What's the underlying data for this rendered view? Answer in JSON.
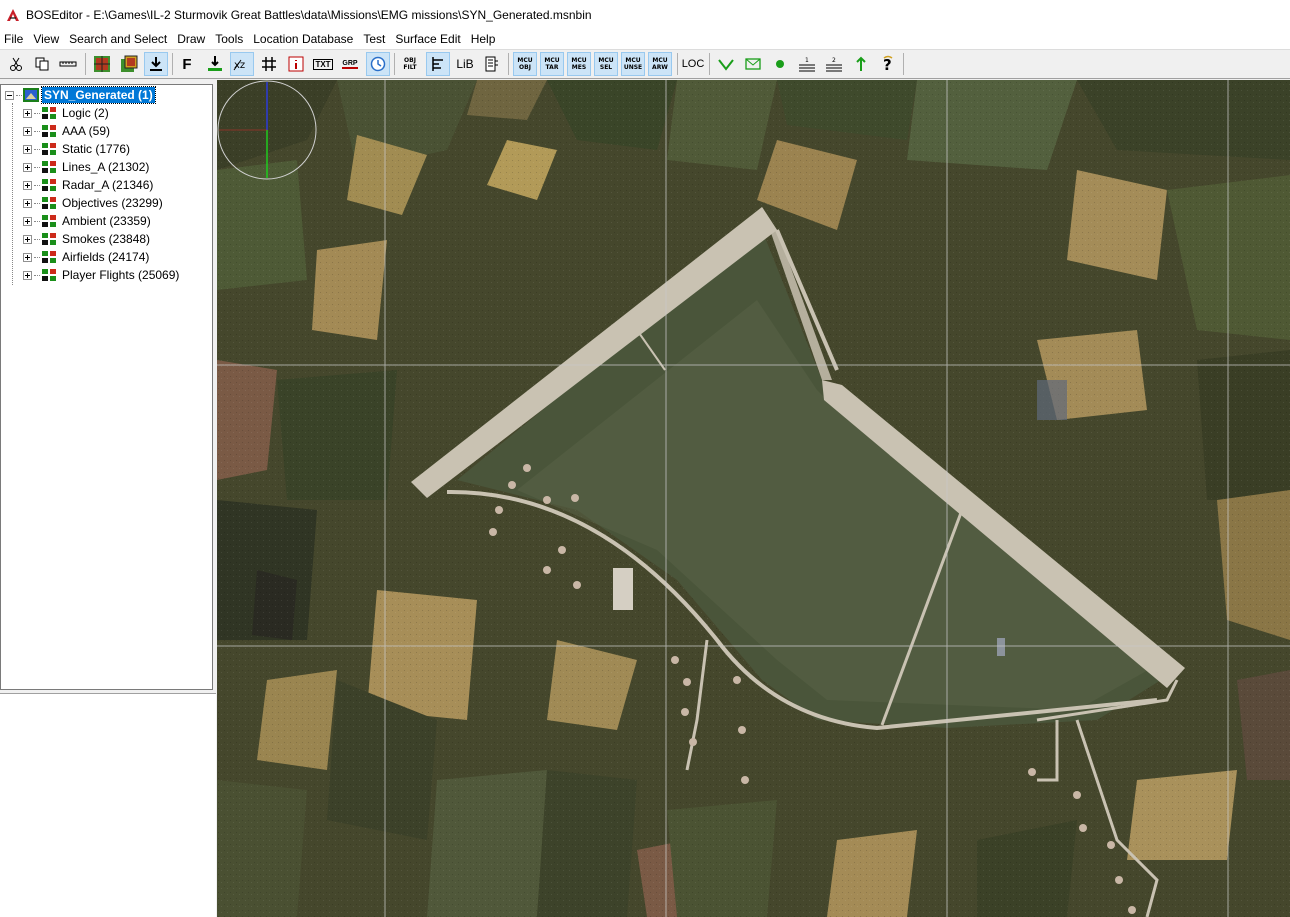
{
  "window": {
    "title": "BOSEditor - E:\\Games\\IL-2 Sturmovik Great Battles\\data\\Missions\\EMG missions\\SYN_Generated.msnbin"
  },
  "menu": [
    {
      "label": "File"
    },
    {
      "label": "View"
    },
    {
      "label": "Search and Select"
    },
    {
      "label": "Draw"
    },
    {
      "label": "Tools"
    },
    {
      "label": "Location Database"
    },
    {
      "label": "Test"
    },
    {
      "label": "Surface Edit"
    },
    {
      "label": "Help"
    }
  ],
  "toolbar": {
    "text_buttons": {
      "f": "F",
      "txt": "TXT",
      "grp": "GRP",
      "obj_filt_1": "OBJ",
      "obj_filt_2": "FILT",
      "lib": "LiB",
      "loc": "LOC",
      "mcu_obj": [
        "MCU",
        "OBJ"
      ],
      "mcu_tar": [
        "MCU",
        "TAR"
      ],
      "mcu_mes": [
        "MCU",
        "MES"
      ],
      "mcu_sel": [
        "MCU",
        "SEL"
      ],
      "mcu_unse": [
        "MCU",
        "UNSE"
      ],
      "mcu_arw": [
        "MCU",
        "ARW"
      ]
    },
    "icons": [
      "cut-icon",
      "copy-icon",
      "ruler-icon",
      "layer-icon",
      "layers-icon",
      "import-icon",
      "ground-icon",
      "xz-icon",
      "grid-icon",
      "info-icon",
      "clock-icon",
      "align-icon",
      "list-icon",
      "check-icon",
      "envelope-icon",
      "dot-icon",
      "layer1-icon",
      "layer2-icon",
      "arrow-up-icon",
      "help-icon"
    ],
    "colors": {
      "active_bg": "#cce4f7",
      "green": "#1a9e1a"
    }
  },
  "tree": {
    "root": {
      "label": "SYN_Generated (1)",
      "selected": true
    },
    "children": [
      {
        "label": "Logic (2)"
      },
      {
        "label": "AAA (59)"
      },
      {
        "label": "Static (1776)"
      },
      {
        "label": "Lines_A (21302)"
      },
      {
        "label": "Radar_A (21346)"
      },
      {
        "label": "Objectives (23299)"
      },
      {
        "label": "Ambient (23359)"
      },
      {
        "label": "Smokes (23848)"
      },
      {
        "label": "Airfields (24174)"
      },
      {
        "label": "Player Flights (25069)"
      }
    ]
  },
  "map": {
    "grid": "on",
    "compass": "top-left",
    "content": "satellite terrain with airfield",
    "colors": {
      "field_dark": "#3f4a2c",
      "field_tan": "#8a7a4a",
      "runway": "#c8c2b4",
      "grass": "#4f5a3c",
      "grid_line": "#c9c9c9"
    }
  }
}
